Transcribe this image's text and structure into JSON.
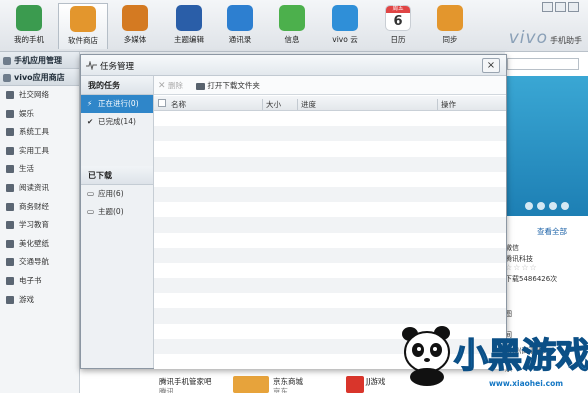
{
  "toolbar": {
    "items": [
      {
        "label": "我的手机",
        "color": "#3b9b4f"
      },
      {
        "label": "软件商店",
        "color": "#e3962d"
      },
      {
        "label": "多媒体",
        "color": "#d47a22"
      },
      {
        "label": "主题编辑",
        "color": "#2a5ea8"
      },
      {
        "label": "通讯录",
        "color": "#2d7fd0"
      },
      {
        "label": "信息",
        "color": "#4cb04c"
      },
      {
        "label": "vivo 云",
        "color": "#2f8fd8"
      },
      {
        "label": "日历",
        "color": "#e04545",
        "top": "周五",
        "num": "6"
      },
      {
        "label": "同步",
        "color": "#e3962d"
      }
    ],
    "brand": "vivo",
    "brand_sub": "手机助手"
  },
  "left_panel": {
    "manage_title": "手机应用管理",
    "store_title": "vivo应用商店",
    "categories": [
      "社交网络",
      "娱乐",
      "系统工具",
      "实用工具",
      "生活",
      "阅读资讯",
      "商务财经",
      "学习教育",
      "美化壁纸",
      "交通导航",
      "电子书",
      "游戏"
    ]
  },
  "right_panel": {
    "more_label": "查看全部",
    "lines": [
      "微信",
      "腾讯科技",
      "下载5486426次",
      "图",
      "间",
      "影视(高清版)",
      "乐",
      "乐"
    ]
  },
  "bottom_strip": {
    "app1_name": "腾讯手机管家吧",
    "app1_sub": "腾讯",
    "app2_name": "京东商城",
    "app2_sub": "京东",
    "app3_name": "JJ游戏"
  },
  "dialog": {
    "title": "任务管理",
    "close": "×",
    "my_tasks_header": "我的任务",
    "in_progress_label": "正在进行(0)",
    "completed_label": "已完成(14)",
    "downloaded_header": "已下载",
    "apps_label": "应用(6)",
    "themes_label": "主题(0)",
    "delete_label": "删除",
    "open_folder_label": "打开下载文件夹",
    "columns": {
      "name": "名称",
      "size": "大小",
      "progress": "进度",
      "action": "操作"
    }
  },
  "watermark": {
    "text": "小黑游戏",
    "url": "www.xiaohei.com"
  }
}
